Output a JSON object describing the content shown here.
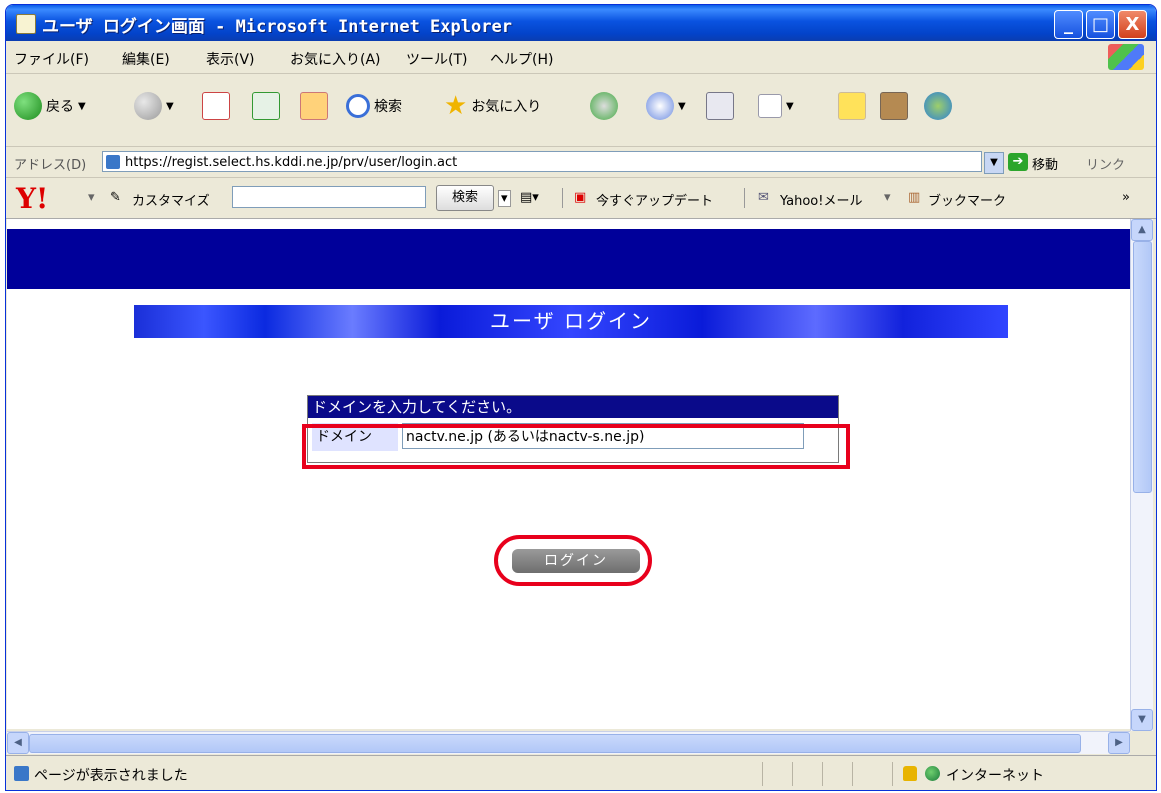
{
  "window": {
    "title": "ユーザ ログイン画面 - Microsoft Internet Explorer",
    "minimize_glyph": "_",
    "maximize_glyph": "□",
    "close_glyph": "X"
  },
  "menu": [
    "ファイル(F)",
    "編集(E)",
    "表示(V)",
    "お気に入り(A)",
    "ツール(T)",
    "ヘルプ(H)"
  ],
  "toolbar": {
    "back": "戻る",
    "search": "検索",
    "favorites": "お気に入り"
  },
  "address": {
    "label": "アドレス(D)",
    "url": "https://regist.select.hs.kddi.ne.jp/prv/user/login.act",
    "go": "移動",
    "links": "リンク"
  },
  "yahoo_bar": {
    "logo": "Y!",
    "customize": "カスタマイズ",
    "search_button": "検索",
    "update": "今すぐアップデート",
    "mail": "Yahoo!メール",
    "bookmark": "ブックマーク",
    "more": "»"
  },
  "page": {
    "heading": "ユーザ ログイン",
    "form_title": "ドメインを入力してください。",
    "domain_label": "ドメイン",
    "domain_value": "nactv.ne.jp (あるいはnactv-s.ne.jp)",
    "login_button": "ログイン"
  },
  "status": {
    "message": "ページが表示されました",
    "zone": "インターネット"
  },
  "colors": {
    "page_band": "#00009a",
    "highlight": "#e8001c",
    "titlebar": "#0a53e0"
  }
}
